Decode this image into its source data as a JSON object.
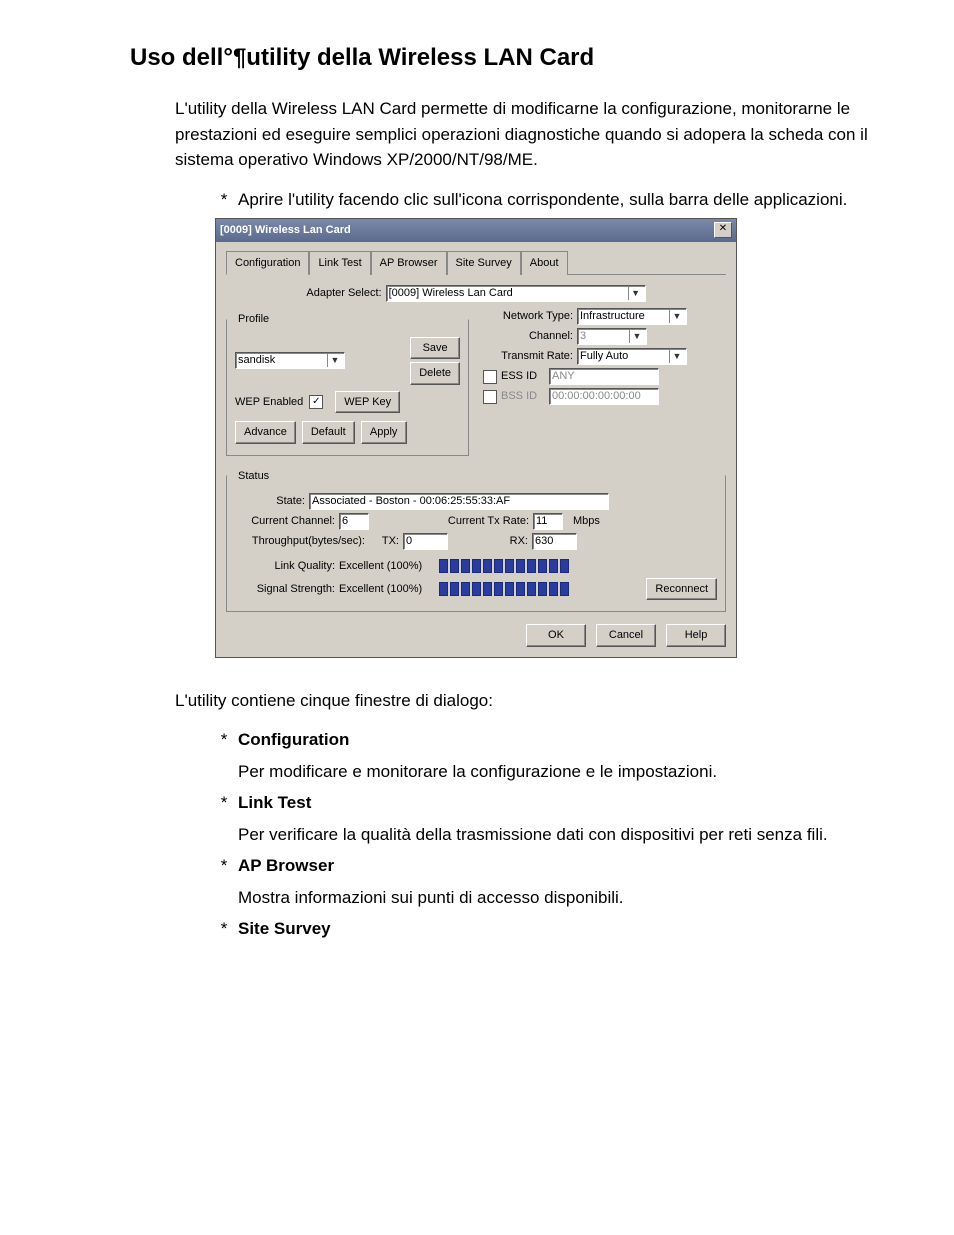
{
  "doc": {
    "heading": "Uso dell°¶utility della Wireless LAN Card",
    "intro": "L'utility della Wireless LAN Card permette di modificarne la configurazione, monitorarne le prestazioni ed eseguire semplici operazioni diagnostiche quando si adopera la scheda con il sistema operativo Windows XP/2000/NT/98/ME.",
    "open_instr": "Aprire l'utility facendo clic sull'icona corrispondente, sulla barra delle applicazioni.",
    "post_screenshot": "L'utility contiene cinque finestre di dialogo:",
    "items": [
      {
        "title": "Configuration",
        "desc": "Per modificare e monitorare la configurazione e le impostazioni."
      },
      {
        "title": "Link Test",
        "desc": "Per verificare la qualità della trasmissione dati con dispositivi per reti senza fili."
      },
      {
        "title": "AP Browser",
        "desc": "Mostra informazioni sui punti di accesso disponibili."
      },
      {
        "title": "Site Survey",
        "desc": ""
      }
    ]
  },
  "win": {
    "title": "[0009] Wireless Lan Card",
    "tabs": [
      "Configuration",
      "Link Test",
      "AP Browser",
      "Site Survey",
      "About"
    ],
    "adapter_label": "Adapter Select:",
    "adapter_value": "[0009] Wireless Lan Card",
    "profile": {
      "legend": "Profile",
      "name": "sandisk",
      "save": "Save",
      "delete": "Delete",
      "wep_enabled_label": "WEP Enabled",
      "wep_key": "WEP Key",
      "advance": "Advance",
      "default": "Default",
      "apply": "Apply"
    },
    "net": {
      "network_type_label": "Network Type:",
      "network_type": "Infrastructure",
      "channel_label": "Channel:",
      "channel": "3",
      "transmit_rate_label": "Transmit Rate:",
      "transmit_rate": "Fully Auto",
      "essid_label": "ESS ID",
      "essid": "ANY",
      "bssid_label": "BSS ID",
      "bssid": "00:00:00:00:00:00"
    },
    "status": {
      "legend": "Status",
      "state_label": "State:",
      "state": "Associated - Boston - 00:06:25:55:33:AF",
      "current_channel_label": "Current Channel:",
      "current_channel": "6",
      "current_tx_rate_label": "Current Tx Rate:",
      "current_tx_rate": "11",
      "mbps": "Mbps",
      "throughput_label": "Throughput(bytes/sec):",
      "tx_label": "TX:",
      "tx": "0",
      "rx_label": "RX:",
      "rx": "630",
      "link_quality_label": "Link Quality:",
      "link_quality": "Excellent (100%)",
      "signal_strength_label": "Signal Strength:",
      "signal_strength": "Excellent (100%)",
      "reconnect": "Reconnect"
    },
    "buttons": {
      "ok": "OK",
      "cancel": "Cancel",
      "help": "Help"
    }
  }
}
